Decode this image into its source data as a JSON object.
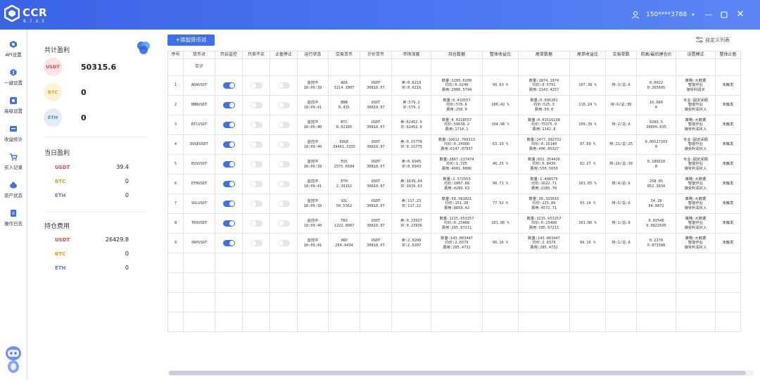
{
  "app": {
    "name": "CCR",
    "version": "8.7.0.5",
    "user_phone": "150****3788",
    "colors": {
      "titlebar": "#4470ee",
      "accent": "#3e6ff1"
    }
  },
  "window_buttons": [
    "chevron-down-icon",
    "minimize-icon",
    "maximize-icon",
    "close-icon"
  ],
  "nav": [
    {
      "label": "API设置",
      "icon": "api-icon"
    },
    {
      "label": "一键设置",
      "icon": "one-click-icon"
    },
    {
      "label": "高级设置",
      "icon": "advanced-settings-icon"
    },
    {
      "label": "收益统计",
      "icon": "stats-icon"
    },
    {
      "label": "买入记录",
      "icon": "cart-icon"
    },
    {
      "label": "资产状态",
      "icon": "assets-icon"
    },
    {
      "label": "操作日志",
      "icon": "log-icon"
    }
  ],
  "panel": {
    "total_profit": {
      "title": "共计盈利",
      "items": [
        {
          "coin": "USDT",
          "value": "50315.6"
        },
        {
          "coin": "BTC",
          "value": "0"
        },
        {
          "coin": "ETH",
          "value": "0"
        }
      ]
    },
    "today_profit": {
      "title": "当日盈利",
      "items": [
        {
          "coin": "USDT",
          "value": "39.4"
        },
        {
          "coin": "BTC",
          "value": "0"
        },
        {
          "coin": "ETH",
          "value": "0"
        }
      ]
    },
    "holding_cost": {
      "title": "持仓费用",
      "items": [
        {
          "coin": "USDT",
          "value": "26429.8"
        },
        {
          "coin": "BTC",
          "value": "0"
        },
        {
          "coin": "ETH",
          "value": "0"
        }
      ]
    }
  },
  "toolbar": {
    "add_label": "+添加货币对",
    "custom_label": "自定义列表"
  },
  "table": {
    "headers": [
      "序号",
      "货币对",
      "开启监控",
      "只卖不买",
      "止盈停止",
      "运行状态",
      "交易货币",
      "计价货币",
      "市场深度",
      "持仓数据",
      "整体收益比",
      "尾单数据",
      "尾单收益比",
      "交易单数",
      "前高/最后建仓价",
      "设置模式",
      "整体止盈"
    ],
    "total_label": "合计",
    "rows": [
      {
        "no": "1",
        "pair": "ADAUSDT",
        "monitor": true,
        "status": [
          "监控中",
          "10:09:39"
        ],
        "trade": [
          "ADA",
          "3214.1007"
        ],
        "quote": [
          "USDT",
          "30818.07"
        ],
        "depth": [
          "卖:0.6219",
          "买:0.6216"
        ],
        "pos": [
          "数量:3205.6200",
          "均价:0.6240",
          "费用:2000.5794"
        ],
        "ratio": "99.63 %",
        "tail": [
          "数量:1874.1974",
          "均价:0.5791",
          "费用:1143.4257"
        ],
        "tail_ratio": "107.38 %",
        "orders": "持:3/总:6",
        "price": [
          "0.0022",
          "0.265605"
        ],
        "mode": [
          "策略:大数据",
          "智能作业",
          "接受利润买"
        ],
        "stop": "未触发"
      },
      {
        "no": "2",
        "pair": "BNBUSDT",
        "monitor": true,
        "status": [
          "监控中",
          "10:09:41"
        ],
        "trade": [
          "BNB",
          "0.435"
        ],
        "quote": [
          "USDT",
          "30818.07"
        ],
        "depth": [
          "卖:579.2",
          "买:579.1"
        ],
        "pos": [
          "数量:0.433557",
          "均价:576.6",
          "费用:250.0"
        ],
        "ratio": "100.42 %",
        "tail": [
          "数量:0.095201",
          "均价:525.3",
          "费用:50.0"
        ],
        "tail_ratio": "110.24 %",
        "orders": "持:6/总:30",
        "price": [
          "16.666",
          "0"
        ],
        "mode": [
          "专业:固定间隔",
          "智能作业",
          "接受利润买入"
        ],
        "stop": "未触发"
      },
      {
        "no": "3",
        "pair": "BTCUSDT",
        "monitor": true,
        "status": [
          "监控中",
          "10:09:40"
        ],
        "trade": [
          "BTC",
          "0.02185"
        ],
        "quote": [
          "USDT",
          "30818.07"
        ],
        "depth": [
          "卖:62452.6",
          "买:62452.6"
        ],
        "pos": [
          "数量:0.0218557",
          "均价:59638.2",
          "费用:1714.1"
        ],
        "ratio": "104.98 %",
        "tail": [
          "数量:0.01516138",
          "均价:75375.9",
          "费用:1142.8"
        ],
        "tail_ratio": "109.39 %",
        "orders": "持:2/总:6",
        "price": [
          "9289.5",
          "30009.035"
        ],
        "mode": [
          "策略:大数据",
          "智能作业",
          "接受利润买入"
        ],
        "stop": "未触发"
      },
      {
        "no": "4",
        "pair": "DOGEUSDT",
        "monitor": true,
        "status": [
          "监控中",
          "10:09:40"
        ],
        "trade": [
          "DOGE",
          "39461.3335"
        ],
        "quote": [
          "USDT",
          "30818.07"
        ],
        "depth": [
          "卖:0.15776",
          "买:0.15775"
        ],
        "pos": [
          "数量:16012.769313",
          "均价:0.24900",
          "费用:6147.07937"
        ],
        "ratio": "63.19 %",
        "tail": [
          "数量:2477.392731",
          "均价:0.16140",
          "费用:400.05327"
        ],
        "tail_ratio": "97.69 %",
        "orders": "持:21/总:25",
        "price": [
          "0.00127103",
          "0"
        ],
        "mode": [
          "专业:固定间隔",
          "智能作业",
          "接受利润买入"
        ],
        "stop": "未触发"
      },
      {
        "no": "5",
        "pair": "EOSUSDT",
        "monitor": true,
        "status": [
          "监控中",
          "10:09:39"
        ],
        "trade": [
          "EOS",
          "2575.6504"
        ],
        "quote": [
          "USDT",
          "30818.07"
        ],
        "depth": [
          "卖:0.6945",
          "买:0.6943"
        ],
        "pos": [
          "数量:2867.217474",
          "均价:1.725",
          "费用:4601.0086"
        ],
        "ratio": "40.25 %",
        "tail": [
          "数量:652.354436",
          "均价:0.8439",
          "费用:550.5650"
        ],
        "tail_ratio": "82.27 %",
        "orders": "持:26/总:30",
        "price": [
          "0.106810",
          "0"
        ],
        "mode": [
          "专业:固定间隔",
          "智能作业",
          "接受利润买入"
        ],
        "stop": "未触发"
      },
      {
        "no": "6",
        "pair": "ETHUSDT",
        "monitor": true,
        "status": [
          "监控中",
          "10:09:41"
        ],
        "trade": [
          "ETH",
          "2.39152"
        ],
        "quote": [
          "USDT",
          "30818.07"
        ],
        "depth": [
          "卖:1639.64",
          "买:1639.63"
        ],
        "pos": [
          "数量:2.372553",
          "均价:1807.88",
          "费用:4289.63"
        ],
        "ratio": "90.71 %",
        "tail": [
          "数量:1.408575",
          "均价:1622.71",
          "费用:2285.70"
        ],
        "tail_ratio": "101.05 %",
        "orders": "持:4/总:6",
        "price": [
          "258.95",
          "852.2839"
        ],
        "mode": [
          "策略:大数据",
          "智能作业",
          "接受利润买入"
        ],
        "stop": "未触发"
      },
      {
        "no": "7",
        "pair": "SOLUSDT",
        "monitor": true,
        "status": [
          "监控中",
          "10:09:39"
        ],
        "trade": [
          "SOL",
          "50.5362"
        ],
        "quote": [
          "USDT",
          "30818.07"
        ],
        "depth": [
          "卖:117.23",
          "买:117.22"
        ],
        "pos": [
          "数量:58.581021",
          "均价:151.20",
          "费用:8859.42"
        ],
        "ratio": "77.52 %",
        "tail": [
          "数量:36.333015",
          "均价:125.89",
          "费用:4572.71"
        ],
        "tail_ratio": "93.14 %",
        "orders": "持:5/总:6",
        "price": [
          "34.28",
          "84.8072"
        ],
        "mode": [
          "策略:大数据",
          "智能作业",
          "接受利润买入"
        ],
        "stop": "未触发"
      },
      {
        "no": "8",
        "pair": "TRXUSDT",
        "monitor": true,
        "status": [
          "监控中",
          "10:09:40"
        ],
        "trade": [
          "TRX",
          "1222.0087"
        ],
        "quote": [
          "USDT",
          "30818.07"
        ],
        "depth": [
          "卖:0.23937",
          "买:0.23936"
        ],
        "pos": [
          "数量:1215.653257",
          "均价:0.23488",
          "费用:285.67211"
        ],
        "ratio": "101.86 %",
        "tail": [
          "数量:1215.653257",
          "均价:0.23488",
          "费用:285.67211"
        ],
        "tail_ratio": "101.86 %",
        "orders": "持:1/总:8",
        "price": [
          "0.02546",
          "0.0822605"
        ],
        "mode": [
          "策略:大数据",
          "智能作业",
          "接受利润买入"
        ],
        "stop": "未触发"
      },
      {
        "no": "9",
        "pair": "XRPUSDT",
        "monitor": true,
        "status": [
          "监控中",
          "10:09:41"
        ],
        "trade": [
          "XRP",
          "204.4434"
        ],
        "quote": [
          "USDT",
          "30818.07"
        ],
        "depth": [
          "卖:2.0208",
          "买:2.0207"
        ],
        "pos": [
          "数量:143.003447",
          "均价:2.0379",
          "费用:285.4732"
        ],
        "ratio": "99.16 %",
        "tail": [
          "数量:143.003447",
          "均价:2.0379",
          "费用:285.4732"
        ],
        "tail_ratio": "99.16 %",
        "orders": "持:1/总:8",
        "price": [
          "0.2278",
          "0.873388"
        ],
        "mode": [
          "策略:大数据",
          "智能作业",
          "接受利润买入"
        ],
        "stop": "未触发"
      }
    ],
    "empty_rows": 4
  }
}
